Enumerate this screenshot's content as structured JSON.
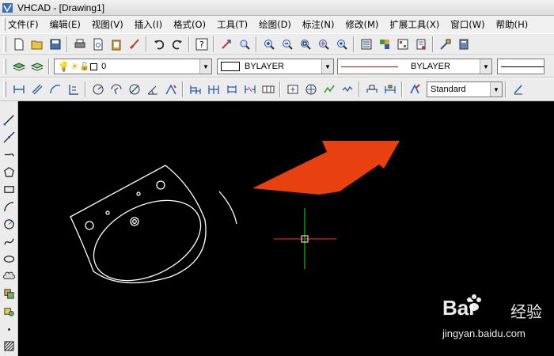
{
  "window": {
    "title": "VHCAD - [Drawing1]"
  },
  "menu": [
    "文件(F)",
    "编辑(E)",
    "视图(V)",
    "插入(I)",
    "格式(O)",
    "工具(T)",
    "绘图(D)",
    "标注(N)",
    "修改(M)",
    "扩展工具(X)",
    "窗口(W)",
    "帮助(H)"
  ],
  "layer_toolbar": {
    "current_layer": "0"
  },
  "properties_toolbar": {
    "color": "BYLAYER",
    "linetype": "BYLAYER"
  },
  "dimension_toolbar": {
    "dim_style": "Standard"
  },
  "watermark": {
    "brand": "Bai",
    "brand_suffix": "经验",
    "url": "jingyan.baidu.com"
  },
  "colors": {
    "arrow": "#e8410f",
    "crosshair_x": "#d62020",
    "crosshair_y": "#1fb81f",
    "drawing": "#ffffff"
  }
}
